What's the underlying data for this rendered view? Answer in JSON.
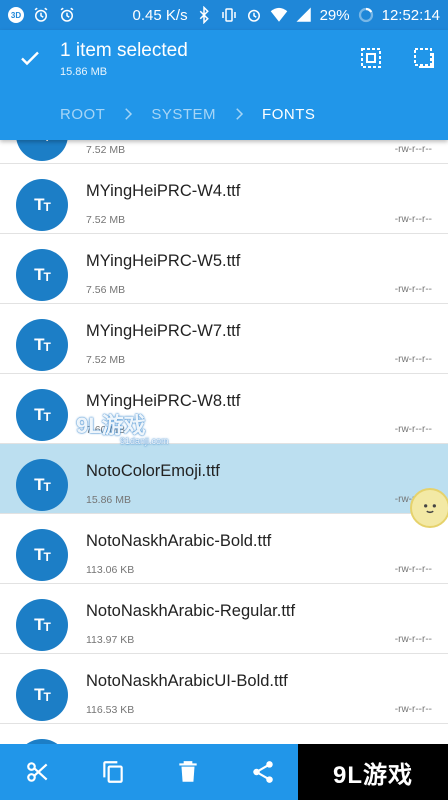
{
  "status_bar": {
    "badge": "3D",
    "network_speed": "0.45 K/s",
    "battery": "29%",
    "time": "12:52:14"
  },
  "header": {
    "title": "1 item selected",
    "size": "15.86 MB",
    "breadcrumb": [
      "ROOT",
      "SYSTEM",
      "FONTS"
    ]
  },
  "files": [
    {
      "name": "",
      "size": "7.52 MB",
      "perm": "-rw-r--r--"
    },
    {
      "name": "MYingHeiPRC-W4.ttf",
      "size": "7.52 MB",
      "perm": "-rw-r--r--"
    },
    {
      "name": "MYingHeiPRC-W5.ttf",
      "size": "7.56 MB",
      "perm": "-rw-r--r--"
    },
    {
      "name": "MYingHeiPRC-W7.ttf",
      "size": "7.52 MB",
      "perm": "-rw-r--r--"
    },
    {
      "name": "MYingHeiPRC-W8.ttf",
      "size": "7.60 MB",
      "perm": "-rw-r--r--"
    },
    {
      "name": "NotoColorEmoji.ttf",
      "size": "15.86 MB",
      "perm": "-rw-r--r--",
      "selected": true
    },
    {
      "name": "NotoNaskhArabic-Bold.ttf",
      "size": "113.06 KB",
      "perm": "-rw-r--r--"
    },
    {
      "name": "NotoNaskhArabic-Regular.ttf",
      "size": "113.97 KB",
      "perm": "-rw-r--r--"
    },
    {
      "name": "NotoNaskhArabicUI-Bold.ttf",
      "size": "116.53 KB",
      "perm": "-rw-r--r--"
    }
  ],
  "icons": {
    "file": "font-file-icon",
    "bottom_actions": [
      "cut-icon",
      "copy-icon",
      "delete-icon",
      "share-icon"
    ]
  },
  "watermark": {
    "logo": "9L游戏",
    "site": "91danji.com"
  },
  "colors": {
    "primary": "#2196e9",
    "status_bar": "#1f87d8",
    "icon_circle": "#1c7ec6",
    "selected_row": "#bcdff0"
  }
}
